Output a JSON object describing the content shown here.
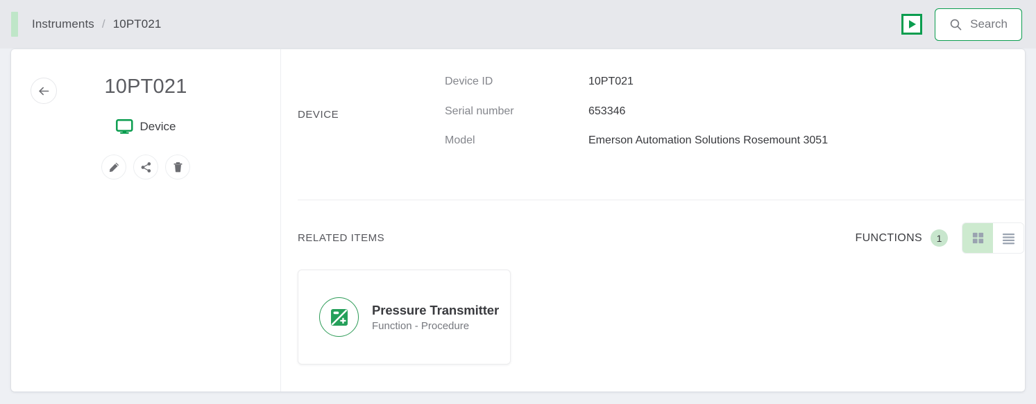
{
  "topbar": {
    "breadcrumb": {
      "root": "Instruments",
      "separator": "/",
      "current": "10PT021"
    },
    "run_icon": "play-square-icon",
    "search": {
      "label": "Search",
      "icon": "search-icon"
    }
  },
  "left_panel": {
    "back_icon": "arrow-left-icon",
    "title": "10PT021",
    "type": {
      "icon": "monitor-icon",
      "label": "Device"
    },
    "actions": [
      {
        "name": "edit",
        "icon": "pencil-icon"
      },
      {
        "name": "share",
        "icon": "share-icon"
      },
      {
        "name": "delete",
        "icon": "trash-icon"
      }
    ]
  },
  "device_section": {
    "caption": "DEVICE",
    "fields": [
      {
        "label": "Device ID",
        "value": "10PT021"
      },
      {
        "label": "Serial number",
        "value": "653346"
      },
      {
        "label": "Model",
        "value": "Emerson Automation Solutions Rosemount 3051"
      }
    ]
  },
  "related_section": {
    "caption": "RELATED ITEMS",
    "functions_label": "FUNCTIONS",
    "functions_count": "1",
    "view_modes": [
      {
        "name": "grid",
        "icon": "grid-view-icon",
        "active": true
      },
      {
        "name": "list",
        "icon": "list-view-icon",
        "active": false
      }
    ],
    "items": [
      {
        "icon": "image-plus-icon",
        "title": "Pressure Transmitter",
        "subtitle": "Function - Procedure"
      }
    ]
  },
  "colors": {
    "accent_green": "#0b9d4f",
    "badge_green": "#c8e6cd",
    "toggle_active_green": "#cdeacf",
    "page_bg": "#eef0f4",
    "topbar_bg": "#e7e8ec"
  }
}
